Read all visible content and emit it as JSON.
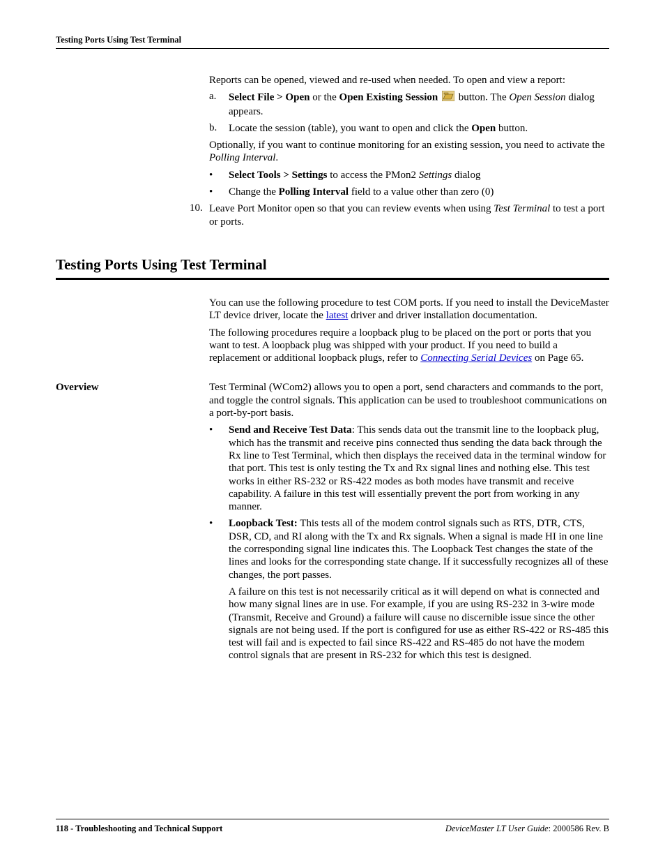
{
  "header": {
    "running_head": "Testing Ports Using Test Terminal"
  },
  "top": {
    "reports_intro": "Reports can be opened, viewed and re-used when needed. To open and view a report:",
    "step_a": {
      "marker": "a.",
      "seg1_bold": "Select File > Open",
      "seg2_plain": " or the ",
      "seg3_bold": "Open Existing Session",
      "seg4_plain": "  button. The ",
      "seg5_ital": "Open Session",
      "seg6_plain": " dialog appears."
    },
    "step_b": {
      "marker": "b.",
      "seg1_plain": "Locate the session (table), you want to open and click the ",
      "seg2_bold": "Open",
      "seg3_plain": " button."
    },
    "optional": {
      "seg1": "Optionally, if you want to continue monitoring for an existing session, you need to activate the ",
      "seg2_ital": "Polling Interval",
      "seg3": "."
    },
    "bullet1": {
      "seg1_bold": "Select Tools > Settings",
      "seg2_plain": " to access the PMon2 ",
      "seg3_ital": "Settings",
      "seg4_plain": " dialog"
    },
    "bullet2": {
      "seg1_plain": "Change the ",
      "seg2_bold": "Polling Interval",
      "seg3_plain": " field to a value other than zero (0)"
    },
    "step10": {
      "marker": "10.",
      "seg1": "Leave Port Monitor open so that you can review events when using ",
      "seg2_ital": "Test Terminal",
      "seg3": " to test a port or ports."
    }
  },
  "section": {
    "heading": "Testing Ports Using Test Terminal",
    "para1": {
      "seg1": "You can use the following procedure to test COM ports. If you need to install the DeviceMaster LT device driver, locate the ",
      "link": "latest",
      "seg2": " driver and driver installation documentation."
    },
    "para2": {
      "seg1": "The following procedures require a loopback plug to be placed on the port or ports that you want to test. A loopback plug was shipped with your product. If you need to build a replacement or additional loopback plugs, refer to ",
      "link_ital": "Connecting Serial Devices",
      "seg2": " on Page 65."
    }
  },
  "overview": {
    "sidehead": "Overview",
    "intro": "Test Terminal (WCom2) allows you to open a port, send characters and commands to the port, and toggle the control signals. This application can be used to troubleshoot communications on a port-by-port basis.",
    "b1": {
      "lead_bold": "Send and Receive Test Data",
      "text": ": This sends data out the transmit line to the loopback plug, which has the transmit and receive pins connected thus sending the data back through the Rx line to Test Terminal, which then displays the received data in the terminal window for that port. This test is only testing the Tx and Rx signal lines and nothing else. This test works in either RS-232 or RS-422 modes as both modes have transmit and receive capability. A failure in this test will essentially prevent the port from working in any manner."
    },
    "b2": {
      "lead_bold": "Loopback Test:",
      "text": " This tests all of the modem control signals such as RTS, DTR, CTS, DSR, CD, and RI along with the Tx and Rx signals. When a signal is made HI in one line the corresponding signal line indicates this. The Loopback Test changes the state of the lines and looks for the corresponding state change. If it successfully recognizes all of these changes, the port passes."
    },
    "b2_follow": "A failure on this test is not necessarily critical as it will depend on what is connected and how many signal lines are in use. For example, if you are using RS-232 in 3-wire mode (Transmit, Receive and Ground) a failure will cause no discernible issue since the other signals are not being used. If the port is configured for use as either RS-422 or RS-485 this test will fail and is expected to fail since RS-422 and RS-485 do not have the modem control signals that are present in RS-232 for which this test is designed."
  },
  "footer": {
    "left_page": "118 - ",
    "left_title": "Troubleshooting and Technical Support",
    "right_ital": "DeviceMaster LT User Guide",
    "right_plain": ": 2000586 Rev. B"
  }
}
